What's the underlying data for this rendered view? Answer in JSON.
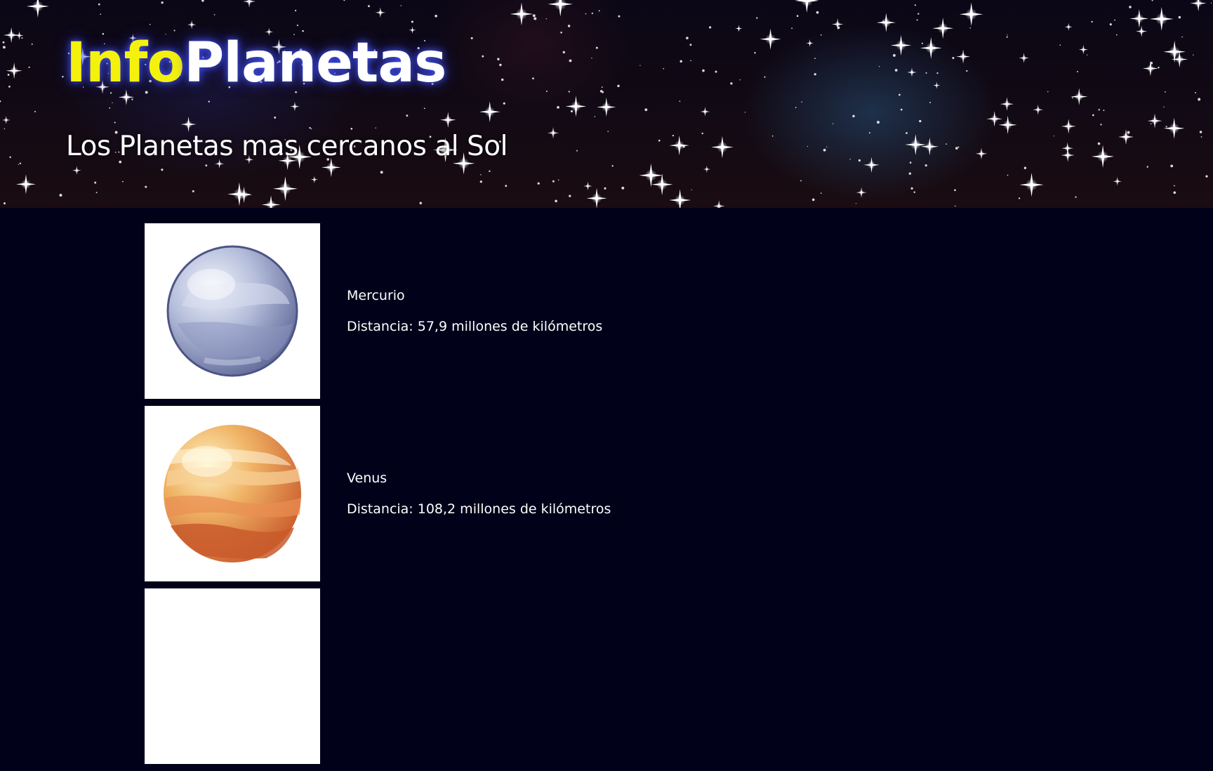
{
  "header": {
    "logo_part1": "Info",
    "logo_part2": "Planetas",
    "subtitle": "Los Planetas mas cercanos al Sol"
  },
  "colors": {
    "background": "#01011a",
    "logo_accent": "#f4f20c",
    "text": "#ffffff",
    "image_card": "#ffffff"
  },
  "planets": [
    {
      "icon": "mercury-planet-icon",
      "name": "Mercurio",
      "distance": "Distancia: 57,9 millones de kilómetros"
    },
    {
      "icon": "venus-planet-icon",
      "name": "Venus",
      "distance": "Distancia: 108,2 millones de kilómetros"
    },
    {
      "icon": "earth-planet-icon"
    }
  ]
}
